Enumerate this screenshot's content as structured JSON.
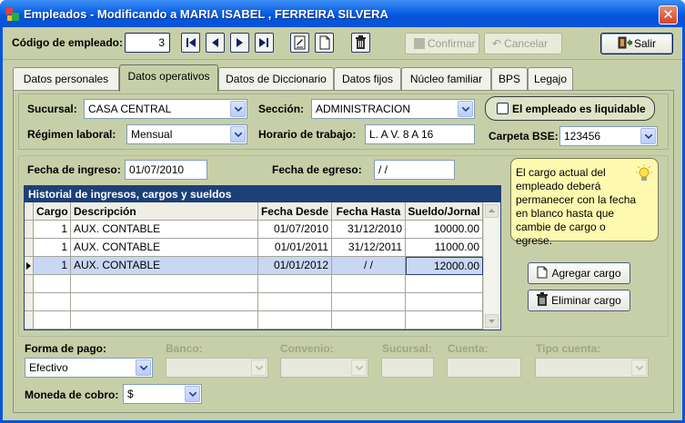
{
  "window": {
    "title": "Empleados - Modificando a MARIA ISABEL , FERREIRA SILVERA"
  },
  "toolbar": {
    "codigo_label": "Código de empleado:",
    "codigo_value": "3",
    "confirmar_label": "Confirmar",
    "cancelar_label": "Cancelar",
    "salir_label": "Salir"
  },
  "tabs": [
    {
      "label": "Datos personales",
      "active": false
    },
    {
      "label": "Datos operativos",
      "active": true
    },
    {
      "label": "Datos de Diccionario",
      "active": false
    },
    {
      "label": "Datos fijos",
      "active": false
    },
    {
      "label": "Núcleo familiar",
      "active": false
    },
    {
      "label": "BPS",
      "active": false
    },
    {
      "label": "Legajo",
      "active": false
    }
  ],
  "form": {
    "sucursal_label": "Sucursal:",
    "sucursal_value": "CASA CENTRAL",
    "seccion_label": "Sección:",
    "seccion_value": "ADMINISTRACION",
    "liquidable_label": "El empleado es liquidable",
    "liquidable_checked": false,
    "regimen_label": "Régimen laboral:",
    "regimen_value": "Mensual",
    "horario_label": "Horario de trabajo:",
    "horario_value": "L. A V. 8 A 16",
    "carpeta_label": "Carpeta BSE:",
    "carpeta_value": "123456",
    "ingreso_label": "Fecha de ingreso:",
    "ingreso_value": "01/07/2010",
    "egreso_label": "Fecha de egreso:",
    "egreso_value": " / /"
  },
  "note": {
    "text": "El cargo actual del empleado deberá permanecer con la fecha en blanco hasta que cambie de cargo o egrese."
  },
  "grid": {
    "title": "Historial de ingresos, cargos y sueldos",
    "headers": [
      "Cargo",
      "Descripción",
      "Fecha Desde",
      "Fecha Hasta",
      "Sueldo/Jornal"
    ],
    "rows": [
      [
        "1",
        "AUX. CONTABLE",
        "01/07/2010",
        "31/12/2010",
        "10000.00"
      ],
      [
        "1",
        "AUX. CONTABLE",
        "01/01/2011",
        "31/12/2011",
        "11000.00"
      ],
      [
        "1",
        "AUX. CONTABLE",
        "01/01/2012",
        " / /",
        "12000.00"
      ]
    ]
  },
  "buttons": {
    "agregar_label": "Agregar cargo",
    "eliminar_label": "Eliminar cargo"
  },
  "pago": {
    "forma_label": "Forma de pago:",
    "forma_value": "Efectivo",
    "banco_label": "Banco:",
    "convenio_label": "Convenio:",
    "sucursal_label": "Sucursal:",
    "cuenta_label": "Cuenta:",
    "tipo_cuenta_label": "Tipo cuenta:",
    "moneda_label": "Moneda de cobro:",
    "moneda_value": "$"
  },
  "colors": {
    "title_bar": "#0a55d8",
    "panel": "#c7cfa8",
    "grid_header": "#1c3f78",
    "selected_row": "#c9d7f3",
    "note": "#fdfab0"
  }
}
